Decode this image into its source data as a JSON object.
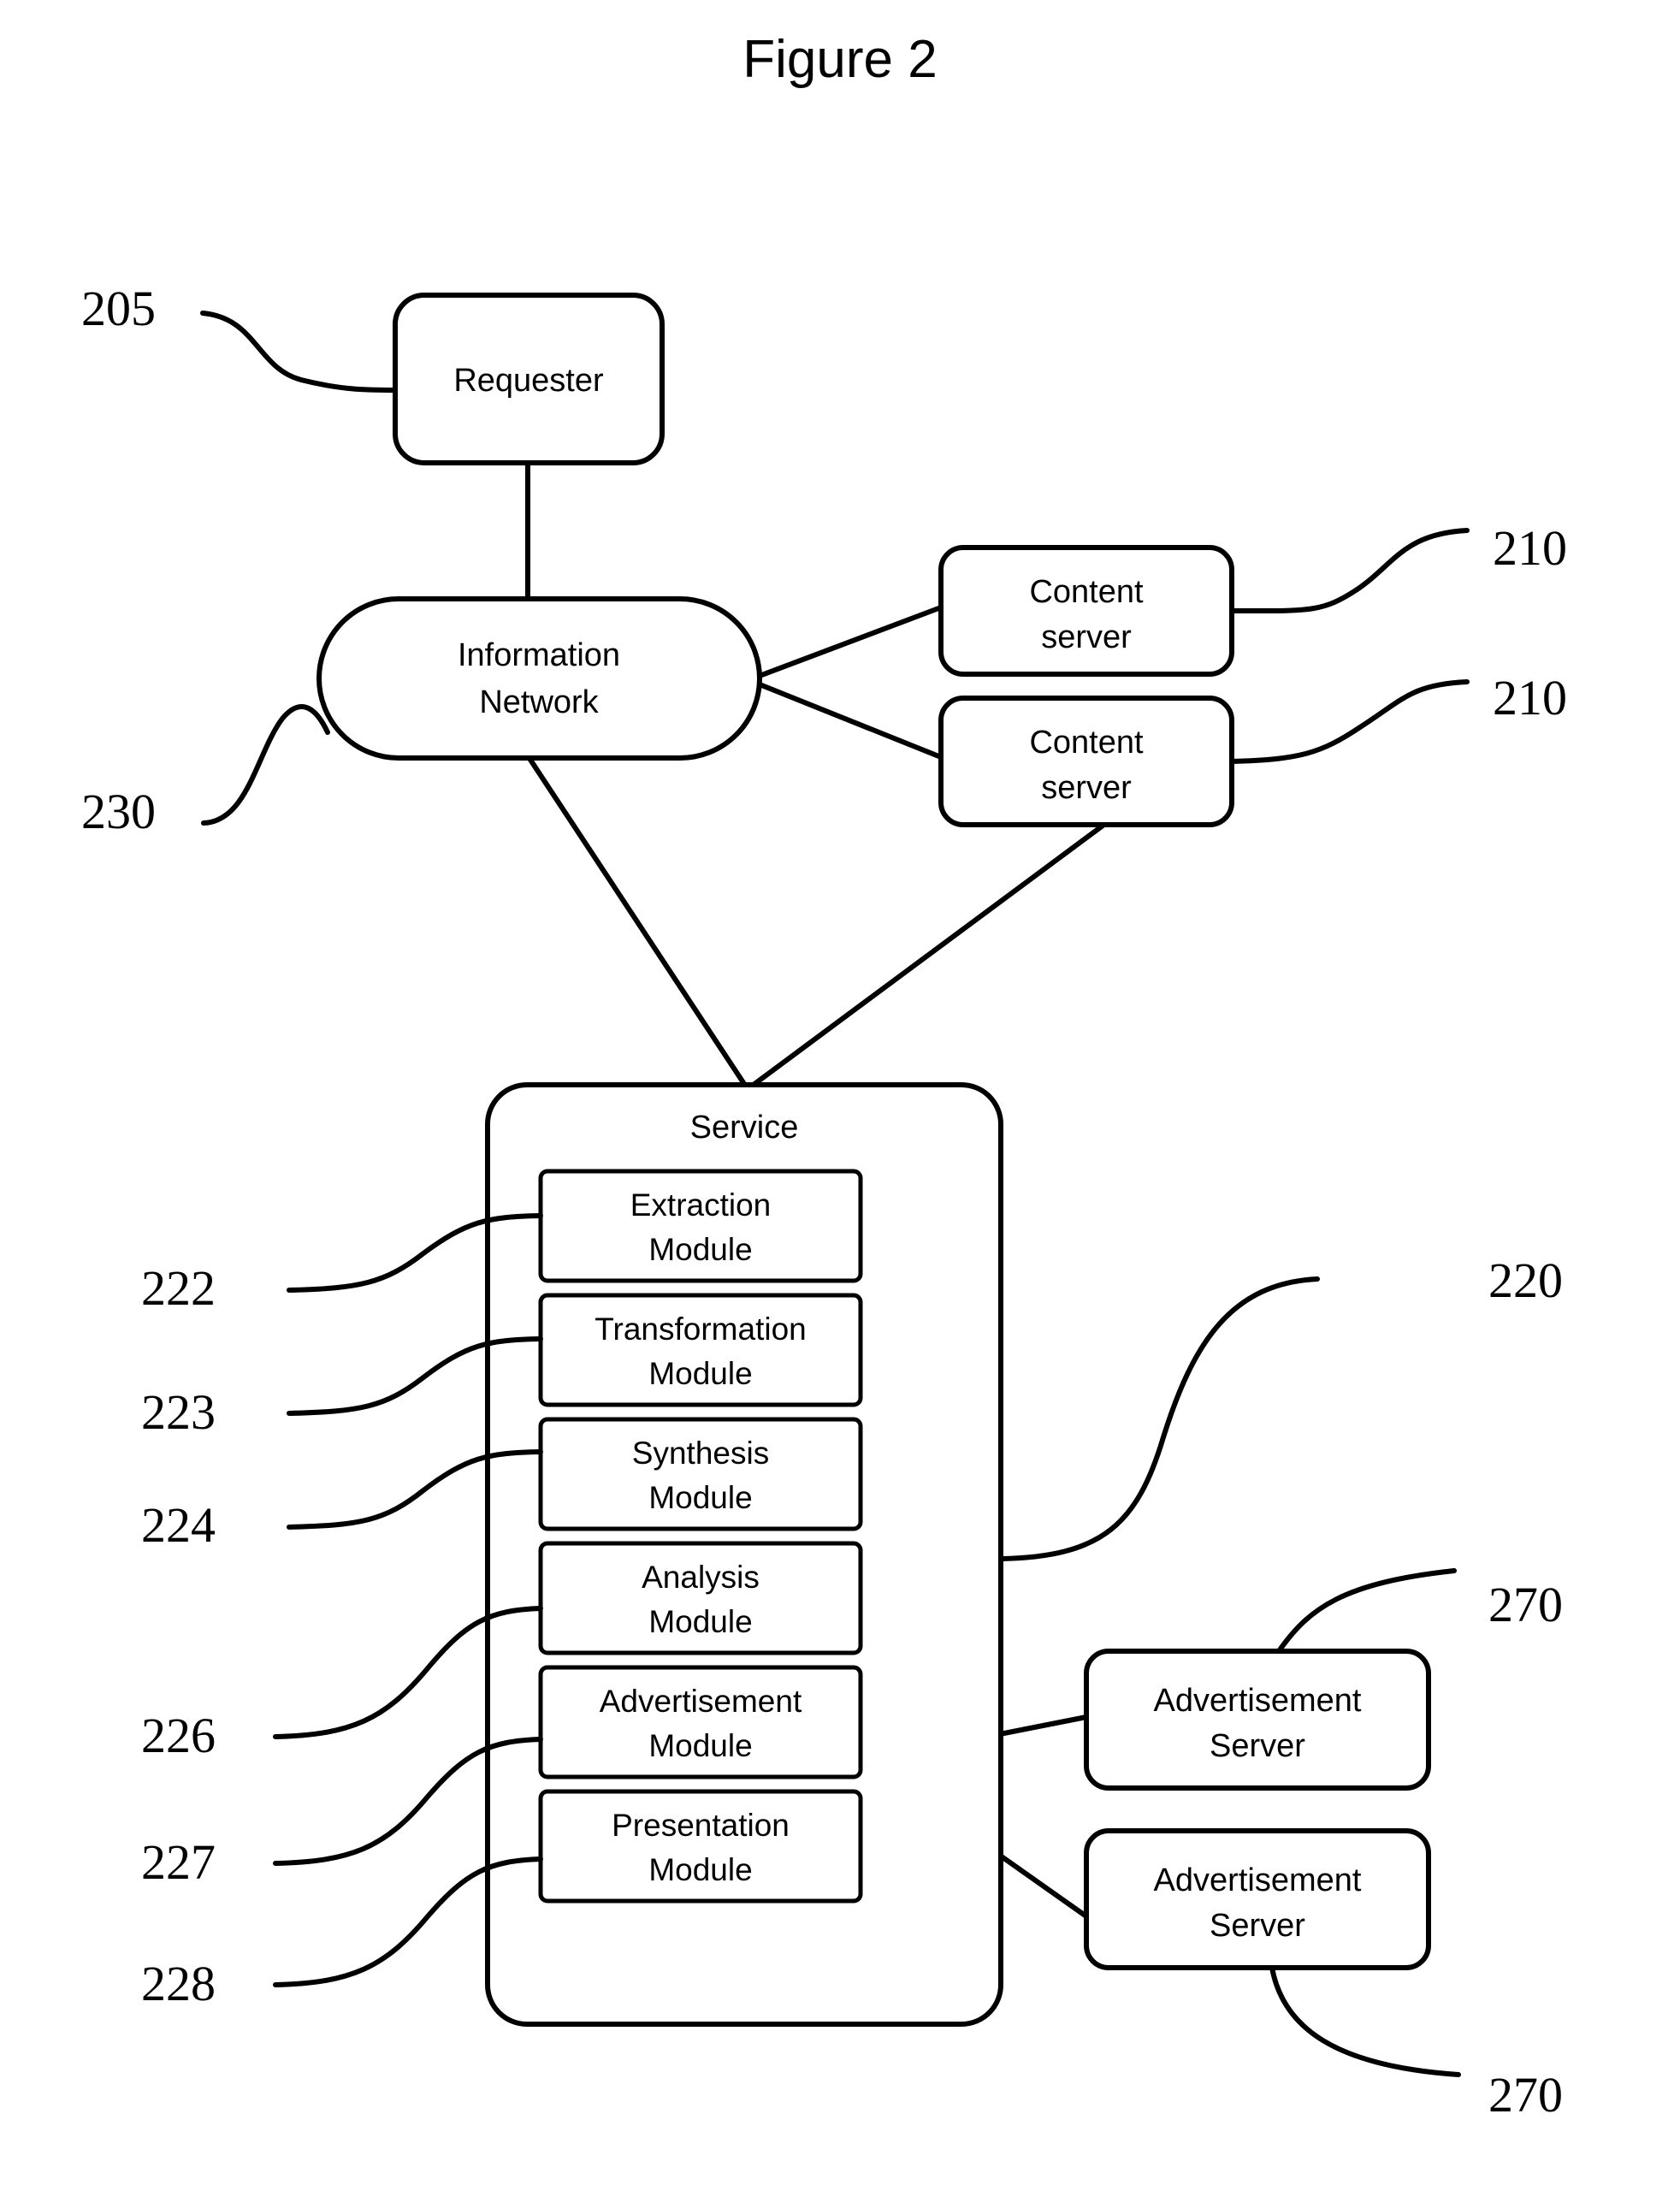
{
  "figure": {
    "title": "Figure 2",
    "type": "patent-block-diagram"
  },
  "nodes": {
    "requester": {
      "label": "Requester"
    },
    "information_network": {
      "line1": "Information",
      "line2": "Network"
    },
    "content_server_1": {
      "line1": "Content",
      "line2": "server"
    },
    "content_server_2": {
      "line1": "Content",
      "line2": "server"
    },
    "service": {
      "label": "Service"
    },
    "ad_server_1": {
      "line1": "Advertisement",
      "line2": "Server"
    },
    "ad_server_2": {
      "line1": "Advertisement",
      "line2": "Server"
    }
  },
  "modules": [
    {
      "id": "extraction",
      "line1": "Extraction",
      "line2": "Module",
      "ref": "222"
    },
    {
      "id": "transformation",
      "line1": "Transformation",
      "line2": "Module",
      "ref": "223"
    },
    {
      "id": "synthesis",
      "line1": "Synthesis",
      "line2": "Module",
      "ref": "224"
    },
    {
      "id": "analysis",
      "line1": "Analysis",
      "line2": "Module",
      "ref": "226"
    },
    {
      "id": "advertisement",
      "line1": "Advertisement",
      "line2": "Module",
      "ref": "227"
    },
    {
      "id": "presentation",
      "line1": "Presentation",
      "line2": "Module",
      "ref": "228"
    }
  ],
  "reference_numerals": {
    "requester": "205",
    "content_server_top": "210",
    "content_server_bottom": "210",
    "information_network": "230",
    "service": "220",
    "extraction_module": "222",
    "transformation_module": "223",
    "synthesis_module": "224",
    "analysis_module": "226",
    "advertisement_module": "227",
    "presentation_module": "228",
    "ad_server_top": "270",
    "ad_server_bottom": "270"
  },
  "colors": {
    "stroke": "#000000",
    "fill": "#ffffff",
    "background": "#ffffff"
  }
}
